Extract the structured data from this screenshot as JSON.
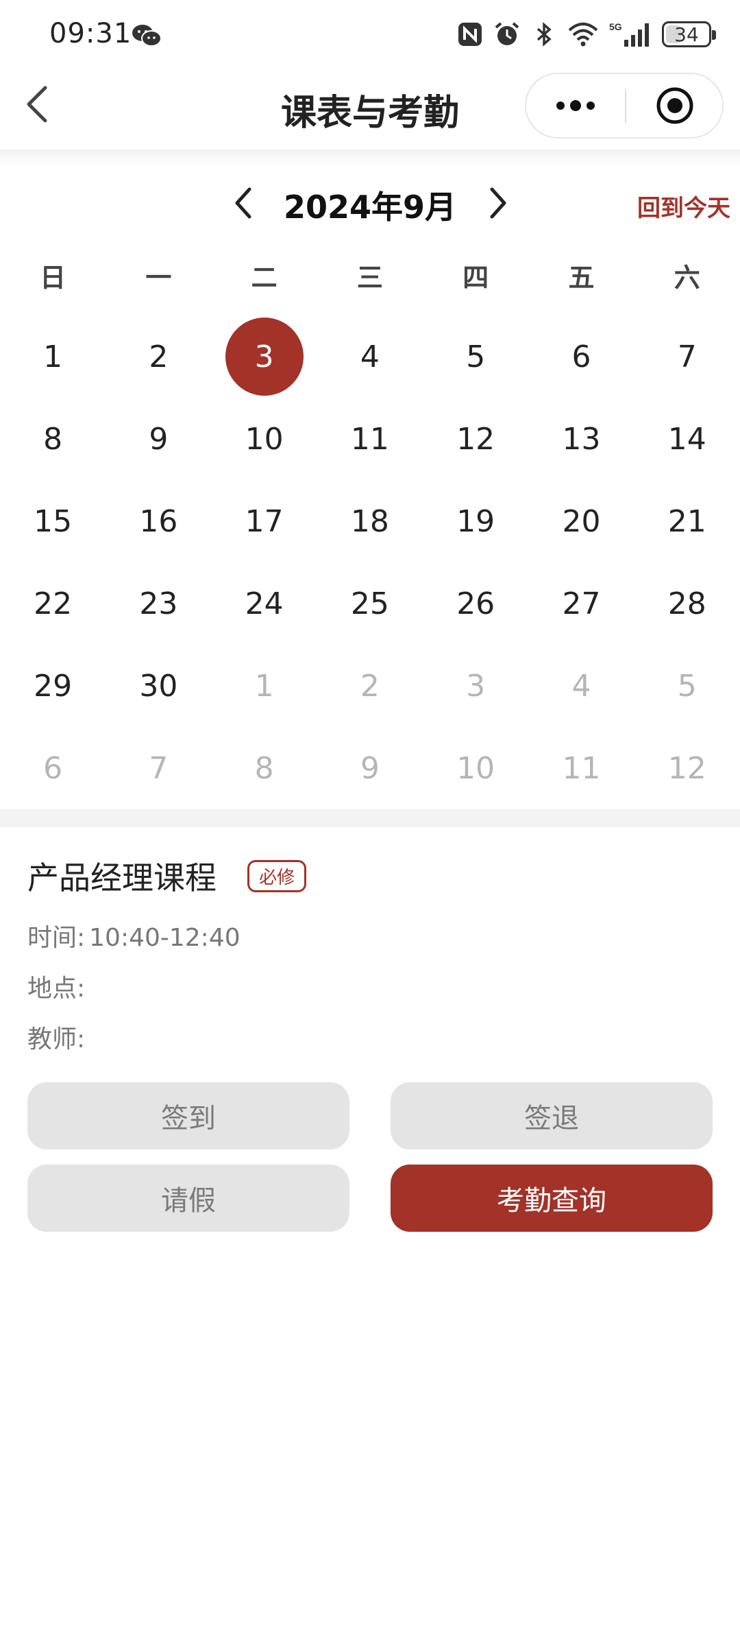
{
  "status_bar": {
    "time": "09:31",
    "icons": [
      "wechat-icon",
      "nfc-icon",
      "alarm-icon",
      "bluetooth-icon",
      "wifi-icon",
      "5g-signal-icon"
    ],
    "battery": "34"
  },
  "nav": {
    "title": "课表与考勤",
    "icons": [
      "back-chevron-icon",
      "more-dots-icon",
      "close-target-icon"
    ]
  },
  "calendar": {
    "month_title": "2024年9月",
    "back_today": "回到今天",
    "weekdays": [
      "日",
      "一",
      "二",
      "三",
      "四",
      "五",
      "六"
    ],
    "days": [
      {
        "d": "1",
        "dim": false
      },
      {
        "d": "2",
        "dim": false
      },
      {
        "d": "3",
        "dim": false,
        "selected": true
      },
      {
        "d": "4",
        "dim": false
      },
      {
        "d": "5",
        "dim": false
      },
      {
        "d": "6",
        "dim": false
      },
      {
        "d": "7",
        "dim": false
      },
      {
        "d": "8",
        "dim": false
      },
      {
        "d": "9",
        "dim": false
      },
      {
        "d": "10",
        "dim": false
      },
      {
        "d": "11",
        "dim": false
      },
      {
        "d": "12",
        "dim": false
      },
      {
        "d": "13",
        "dim": false
      },
      {
        "d": "14",
        "dim": false
      },
      {
        "d": "15",
        "dim": false
      },
      {
        "d": "16",
        "dim": false
      },
      {
        "d": "17",
        "dim": false
      },
      {
        "d": "18",
        "dim": false
      },
      {
        "d": "19",
        "dim": false
      },
      {
        "d": "20",
        "dim": false
      },
      {
        "d": "21",
        "dim": false
      },
      {
        "d": "22",
        "dim": false
      },
      {
        "d": "23",
        "dim": false
      },
      {
        "d": "24",
        "dim": false
      },
      {
        "d": "25",
        "dim": false
      },
      {
        "d": "26",
        "dim": false
      },
      {
        "d": "27",
        "dim": false
      },
      {
        "d": "28",
        "dim": false
      },
      {
        "d": "29",
        "dim": false
      },
      {
        "d": "30",
        "dim": false
      },
      {
        "d": "1",
        "dim": true
      },
      {
        "d": "2",
        "dim": true
      },
      {
        "d": "3",
        "dim": true
      },
      {
        "d": "4",
        "dim": true
      },
      {
        "d": "5",
        "dim": true
      },
      {
        "d": "6",
        "dim": true
      },
      {
        "d": "7",
        "dim": true
      },
      {
        "d": "8",
        "dim": true
      },
      {
        "d": "9",
        "dim": true
      },
      {
        "d": "10",
        "dim": true
      },
      {
        "d": "11",
        "dim": true
      },
      {
        "d": "12",
        "dim": true
      }
    ]
  },
  "course": {
    "title": "产品经理课程",
    "tag": "必修",
    "time_label": "时间:",
    "time_value": "10:40-12:40",
    "location_label": "地点:",
    "teacher_label": "教师:"
  },
  "buttons": {
    "sign_in": "签到",
    "sign_out": "签退",
    "leave": "请假",
    "attendance_query": "考勤查询"
  },
  "colors": {
    "accent": "#a33228",
    "button_gray": "#e4e4e4",
    "dim_text": "#b5b5b5"
  }
}
